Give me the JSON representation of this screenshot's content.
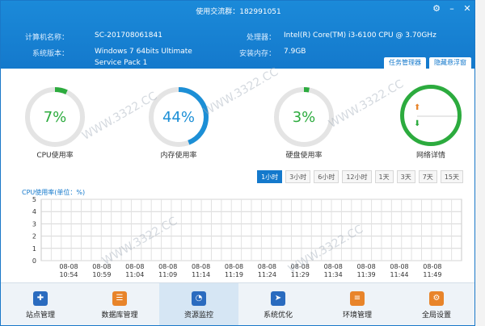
{
  "window": {
    "title": "使用交流群：182991051",
    "icons": [
      "gear-icon",
      "minimize-icon",
      "close-icon"
    ]
  },
  "info": {
    "computer_name_label": "计算机名称：",
    "computer_name": "SC-201708061841",
    "os_label": "系统版本：",
    "os": "Windows 7 64bits Ultimate Service Pack 1",
    "cpu_label": "处理器：",
    "cpu": "Intel(R) Core(TM) i3-6100 CPU @ 3.70GHz",
    "ram_label": "安装内存：",
    "ram": "7.9GB"
  },
  "tabs": [
    "任务管理器",
    "隐藏悬浮窗"
  ],
  "gauges": [
    {
      "label": "CPU使用率",
      "value": "7%",
      "percent": 7,
      "color": "#2cab3e"
    },
    {
      "label": "内存使用率",
      "value": "44%",
      "percent": 44,
      "color": "#1c8fd6"
    },
    {
      "label": "硬盘使用率",
      "value": "3%",
      "percent": 3,
      "color": "#2cab3e"
    }
  ],
  "network": {
    "label": "网络详情"
  },
  "ranges": {
    "options": [
      "1小时",
      "3小时",
      "6小时",
      "12小时",
      "1天",
      "3天",
      "7天",
      "15天"
    ],
    "active": "1小时"
  },
  "chart_data": {
    "type": "line",
    "title": "CPU使用率(单位：%)",
    "ylim": [
      0,
      5
    ],
    "yticks": [
      "0",
      "1",
      "2",
      "3",
      "4",
      "5"
    ],
    "x_dates": [
      "08-08",
      "08-08",
      "08-08",
      "08-08",
      "08-08",
      "08-08",
      "08-08",
      "08-08",
      "08-08",
      "08-08",
      "08-08",
      "08-08",
      "08-08",
      "08-08"
    ],
    "x_times": [
      "10:54",
      "10:59",
      "11:04",
      "11:09",
      "11:14",
      "11:19",
      "11:24",
      "11:29",
      "11:34",
      "11:39",
      "11:44",
      "11:49"
    ],
    "series": [],
    "grid": true
  },
  "nav": [
    {
      "label": "站点管理",
      "icon": "wrench-icon",
      "color": "#2a6bbf"
    },
    {
      "label": "数据库管理",
      "icon": "database-icon",
      "color": "#e8842a"
    },
    {
      "label": "资源监控",
      "icon": "gauge-icon",
      "color": "#2a6bbf"
    },
    {
      "label": "系统优化",
      "icon": "rocket-icon",
      "color": "#2a6bbf"
    },
    {
      "label": "环境管理",
      "icon": "server-icon",
      "color": "#e8842a"
    },
    {
      "label": "全局设置",
      "icon": "monitor-settings-icon",
      "color": "#e8842a"
    }
  ],
  "active_nav": "资源监控",
  "watermark": "WWW.3322.CC"
}
